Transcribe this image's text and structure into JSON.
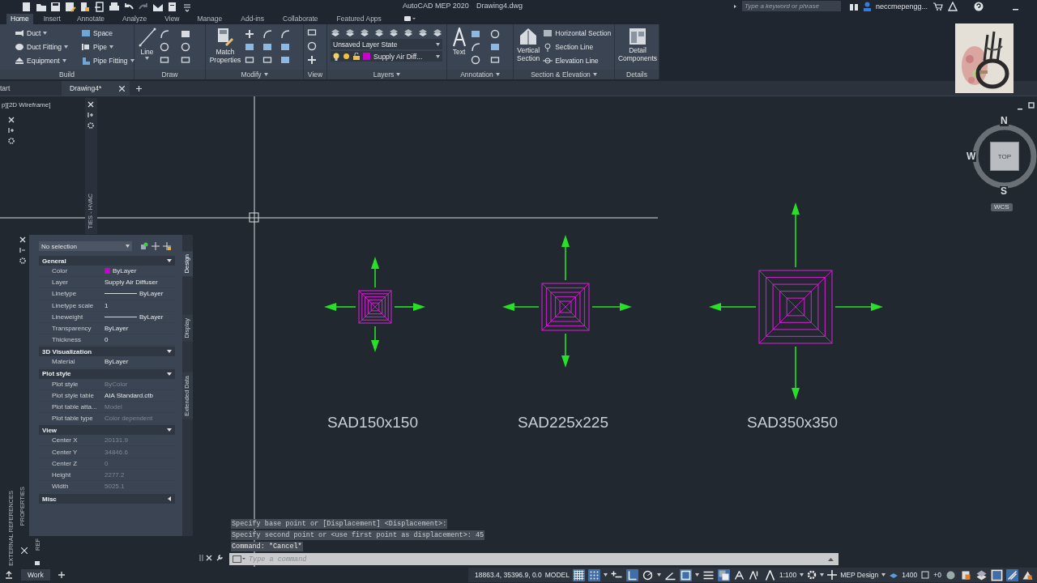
{
  "title_bar": {
    "app": "AutoCAD MEP 2020",
    "file": "Drawing4.dwg",
    "search": {
      "placeholder": "Type a keyword or phrase"
    },
    "user": "neccmepengg..."
  },
  "ribbon_tabs": [
    {
      "label": "Home",
      "selected": true
    },
    {
      "label": "Insert",
      "selected": false
    },
    {
      "label": "Annotate",
      "selected": false
    },
    {
      "label": "Analyze",
      "selected": false
    },
    {
      "label": "View",
      "selected": false
    },
    {
      "label": "Manage",
      "selected": false
    },
    {
      "label": "Add-ins",
      "selected": false
    },
    {
      "label": "Collaborate",
      "selected": false
    },
    {
      "label": "Featured Apps",
      "selected": false
    }
  ],
  "ribbon_panels": [
    {
      "kind": "build",
      "title": "Build",
      "menu": false,
      "tools": [
        {
          "label": "Duct",
          "menu": true
        },
        {
          "label": "Duct Fitting",
          "menu": true
        },
        {
          "label": "Equipment",
          "menu": true
        },
        {
          "label": "Space",
          "menu": false
        },
        {
          "label": "Pipe",
          "menu": true
        },
        {
          "label": "Pipe Fitting",
          "menu": true
        }
      ]
    },
    {
      "kind": "draw",
      "title": "Draw",
      "menu": false,
      "tools": [
        {
          "label": "Line",
          "menu": true
        }
      ]
    },
    {
      "kind": "modify",
      "title": "Modify",
      "menu": true,
      "tools": [
        {
          "label": "Match Properties",
          "menu": false
        }
      ]
    },
    {
      "kind": "view",
      "title": "View",
      "menu": false
    },
    {
      "kind": "layers",
      "title": "Layers",
      "menu": true,
      "layer_state": "Unsaved Layer State",
      "layer": {
        "name": "Supply Air Diff...",
        "color": "#cc00cc"
      }
    },
    {
      "kind": "annotation",
      "title": "Annotation",
      "menu": true,
      "tools": [
        {
          "label": "Text",
          "menu": false
        }
      ]
    },
    {
      "kind": "section",
      "title": "Section & Elevation",
      "menu": true,
      "tools": [
        {
          "label": "Vertical Section",
          "menu": false
        },
        {
          "label": "Horizontal Section",
          "menu": false
        },
        {
          "label": "Section Line",
          "menu": false
        },
        {
          "label": "Elevation Line",
          "menu": false
        }
      ]
    },
    {
      "kind": "details",
      "title": "Details",
      "menu": false,
      "tools": [
        {
          "label": "Detail Components",
          "menu": false
        }
      ]
    }
  ],
  "file_tabs": [
    {
      "label": "tart",
      "selected": false,
      "closable": false
    },
    {
      "label": "Drawing4*",
      "selected": true,
      "closable": true
    }
  ],
  "viewport_label": "p][2D Wireframe]",
  "tool_palette_title": "TIES - HVAC",
  "diffusers": [
    {
      "label": "SAD150x150"
    },
    {
      "label": "SAD225x225"
    },
    {
      "label": "SAD350x350"
    }
  ],
  "viewcube": {
    "north": "N",
    "south": "S",
    "west": "W",
    "face": "TOP",
    "ucs": "WCS"
  },
  "properties": {
    "selection": "No selection",
    "side_tabs": [
      {
        "label": "Design",
        "selected": true
      },
      {
        "label": "Display",
        "selected": false
      },
      {
        "label": "Extended Data",
        "selected": false
      }
    ],
    "sections": [
      {
        "title": "General",
        "expanded": true,
        "rows": [
          {
            "label": "Color",
            "value": "ByLayer",
            "kind": "color",
            "color": "#cc00cc",
            "disabled": false
          },
          {
            "label": "Layer",
            "value": "Supply Air Diffuser",
            "kind": "text",
            "disabled": false
          },
          {
            "label": "Linetype",
            "value": "ByLayer",
            "kind": "line",
            "disabled": false
          },
          {
            "label": "Linetype scale",
            "value": "1",
            "kind": "text",
            "disabled": false
          },
          {
            "label": "Lineweight",
            "value": "ByLayer",
            "kind": "line",
            "disabled": false
          },
          {
            "label": "Transparency",
            "value": "ByLayer",
            "kind": "text",
            "disabled": false
          },
          {
            "label": "Thickness",
            "value": "0",
            "kind": "text",
            "disabled": false
          }
        ]
      },
      {
        "title": "3D Visualization",
        "expanded": true,
        "rows": [
          {
            "label": "Material",
            "value": "ByLayer",
            "kind": "text",
            "disabled": false
          }
        ]
      },
      {
        "title": "Plot style",
        "expanded": true,
        "rows": [
          {
            "label": "Plot style",
            "value": "ByColor",
            "kind": "text",
            "disabled": true
          },
          {
            "label": "Plot style table",
            "value": "AIA Standard.ctb",
            "kind": "text",
            "disabled": false
          },
          {
            "label": "Plot table atta...",
            "value": "Model",
            "kind": "text",
            "disabled": true
          },
          {
            "label": "Plot table type",
            "value": "Color dependent",
            "kind": "text",
            "disabled": true
          }
        ]
      },
      {
        "title": "View",
        "expanded": true,
        "rows": [
          {
            "label": "Center X",
            "value": "20131.9",
            "kind": "text",
            "disabled": true
          },
          {
            "label": "Center Y",
            "value": "34846.6",
            "kind": "text",
            "disabled": true
          },
          {
            "label": "Center Z",
            "value": "0",
            "kind": "text",
            "disabled": true
          },
          {
            "label": "Height",
            "value": "2277.2",
            "kind": "text",
            "disabled": true
          },
          {
            "label": "Width",
            "value": "5025.1",
            "kind": "text",
            "disabled": true
          }
        ]
      },
      {
        "title": "Misc",
        "expanded": false
      }
    ]
  },
  "side_labels": [
    "EXTERNAL REFERENCES",
    "PROPERTIES",
    "REF"
  ],
  "command_history": [
    "Specify base point or [Displacement] <Displacement>:",
    "Specify second point or <use first point as displacement>: 45",
    "Command: *Cancel*"
  ],
  "command_line": {
    "placeholder": "Type a command"
  },
  "layout_tabs": [
    {
      "label": "Work",
      "selected": true
    }
  ],
  "status_bar": {
    "coordinates": "18863.4, 35396.9, 0.0",
    "space": "MODEL",
    "toggles": [
      {
        "kind": "grid",
        "on": true
      },
      {
        "kind": "snap",
        "on": true
      },
      {
        "kind": "infer",
        "on": false
      },
      {
        "kind": "ortho",
        "on": true
      },
      {
        "kind": "polar",
        "on": false
      },
      {
        "kind": "isodraft",
        "on": false
      },
      {
        "kind": "osnap",
        "on": true
      },
      {
        "kind": "lineweight",
        "on": false
      },
      {
        "kind": "transparency",
        "on": true
      },
      {
        "kind": "annovis",
        "on": false
      },
      {
        "kind": "autoscale",
        "on": false
      },
      {
        "kind": "annoscale",
        "on": false
      }
    ],
    "scale": "1:100",
    "workspace": "MEP Design",
    "elevation": "1400",
    "offset": "+0",
    "tail_toggles": [
      {
        "kind": "isolate",
        "on": false
      },
      {
        "kind": "hardware",
        "on": false
      },
      {
        "kind": "layers",
        "on": false
      },
      {
        "kind": "clean",
        "on": true
      },
      {
        "kind": "props",
        "on": true
      },
      {
        "kind": "render",
        "on": false
      }
    ]
  }
}
